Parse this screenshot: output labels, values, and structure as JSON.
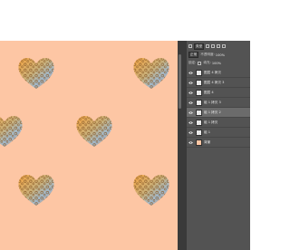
{
  "panel": {
    "filter_kind": "类型",
    "blend_mode": "正常",
    "opacity_label": "不透明度:",
    "opacity_value": "100%",
    "lock_label": "锁定:",
    "fill_label": "填充:",
    "fill_value": "100%"
  },
  "layers": [
    {
      "name": "图层 4 拷贝"
    },
    {
      "name": "图层 4 拷贝 3"
    },
    {
      "name": "图层 4"
    },
    {
      "name": "组 1 拷贝 3"
    },
    {
      "name": "组 1 拷贝 2"
    },
    {
      "name": "组 1 拷贝"
    },
    {
      "name": "组 1"
    },
    {
      "name": "背景"
    }
  ],
  "colors": {
    "canvas": "#fdc6a4",
    "panel": "#535353",
    "divider": "#3a3a3a"
  },
  "icons": [
    "eye-icon",
    "layer-filter-icon",
    "pixel-filter-icon",
    "adjustment-filter-icon",
    "type-filter-icon",
    "shape-filter-icon",
    "lock-icon"
  ]
}
